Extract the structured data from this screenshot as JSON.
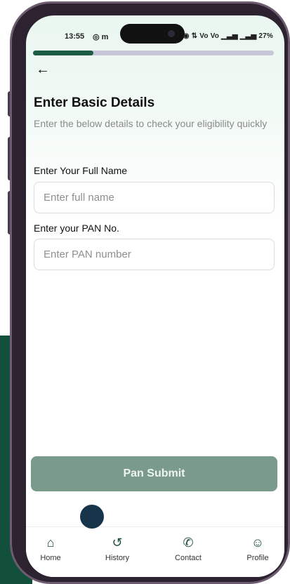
{
  "status_bar": {
    "time": "13:55",
    "left_icons": "◎ m",
    "right_icons": "◉ ⇅ Vo Vo ▁▃▅ ▁▃▅",
    "battery": "27%"
  },
  "progress": {
    "fraction": 0.25,
    "color": "#1d5c45"
  },
  "header": {
    "back_label": "←"
  },
  "page": {
    "title": "Enter Basic Details",
    "subtitle": "Enter the below details to check your eligibility quickly"
  },
  "form": {
    "name_label": "Enter Your Full Name",
    "name_placeholder": "Enter full name",
    "name_value": "",
    "pan_label": "Enter your PAN No.",
    "pan_placeholder": "Enter PAN number",
    "pan_value": ""
  },
  "submit": {
    "label": "Pan Submit",
    "color": "#7a9b8c"
  },
  "nav": {
    "items": [
      {
        "label": "Home",
        "icon": "home-icon",
        "glyph": "⌂"
      },
      {
        "label": "History",
        "icon": "history-icon",
        "glyph": "↺"
      },
      {
        "label": "Contact",
        "icon": "phone-icon",
        "glyph": "✆"
      },
      {
        "label": "Profile",
        "icon": "profile-icon",
        "glyph": "☺"
      }
    ]
  }
}
